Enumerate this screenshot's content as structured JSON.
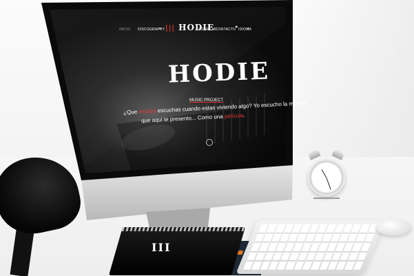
{
  "nav": {
    "items": [
      "INICIO",
      "DISCOGRAPHY",
      "SOBRE MI",
      "CONTACTO"
    ],
    "logo": "HODIE",
    "language": "ES",
    "language_label": "IDIOMA"
  },
  "hero": {
    "logo": "HODIE",
    "tagline": "MUSIC PROJECT",
    "line1_pre": "¿Que ",
    "line1_accent": "música",
    "line1_post": " escuchas cuando estas viviendo algo? Yo escucho la música",
    "line2_pre": "que aqui te presento... Como una ",
    "line2_accent": "película",
    "line2_post": "."
  },
  "notebook": {
    "logo": "III"
  },
  "colors": {
    "accent": "#e53935",
    "screen_bg": "#111111",
    "bezel": "#0a0a0a",
    "aluminum": "#c7c7c7"
  },
  "icons": [
    "chevron-down-icon",
    "flag-icon",
    "scroll-down-icon",
    "clock-icon",
    "lamp-icon",
    "mouse-icon",
    "keyboard-icon"
  ]
}
